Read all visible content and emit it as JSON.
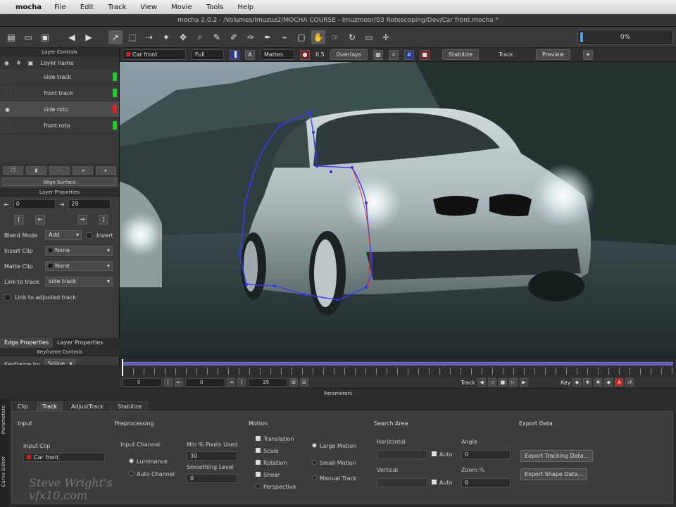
{
  "menubar": {
    "app": "mocha",
    "items": [
      "File",
      "Edit",
      "Track",
      "View",
      "Movie",
      "Tools",
      "Help"
    ]
  },
  "titlebar": {
    "text": "mocha 2.0.2 - /Volumes/Imuzuz2/MOCHA COURSE - Imuzmoor/03 Rotoscoping/Dev/Car front.mocha *"
  },
  "progress": {
    "text": "0%"
  },
  "viewer_bar": {
    "clip": "Car front",
    "view": "Full",
    "mattes": "Mattes",
    "opacity": "0.5",
    "overlays": "Overlays",
    "stabilize": "Stabilize",
    "track": "Track",
    "preview": "Preview"
  },
  "layer_controls": {
    "header": "Layer Controls",
    "column": "Layer name",
    "layers": [
      {
        "name": "side track",
        "color": "#22cc22"
      },
      {
        "name": "front track",
        "color": "#22cc22"
      },
      {
        "name": "side roto",
        "color": "#dd2222"
      },
      {
        "name": "front roto",
        "color": "#22cc22"
      }
    ],
    "align_surface": "Align Surface"
  },
  "layer_properties": {
    "header": "Layer Properties",
    "in_value": "0",
    "out_value": "29",
    "blend_mode_label": "Blend Mode",
    "blend_mode": "Add",
    "invert_label": "Invert",
    "insert_clip_label": "Insert Clip",
    "insert_clip": "None",
    "matte_clip_label": "Matte Clip",
    "matte_clip": "None",
    "link_track_label": "Link to track",
    "link_track": "side track",
    "link_adjusted_label": "Link to adjusted track"
  },
  "left_tabs": {
    "edge": "Edge Properties",
    "layer": "Layer Properties"
  },
  "keyframe": {
    "header": "Keyframe Controls",
    "label": "Keyframe by",
    "value": "Spline"
  },
  "transport": {
    "start": "0",
    "current": "0",
    "end": "29",
    "track": "Track",
    "key": "Key"
  },
  "parameters": {
    "header": "Parameters",
    "side_tabs": [
      "Parameters",
      "Curve Editor"
    ],
    "tabs": [
      "Clip",
      "Track",
      "AdjustTrack",
      "Stabilize"
    ],
    "input": {
      "title": "Input",
      "clip_label": "Input Clip",
      "clip": "Car front"
    },
    "preprocessing": {
      "title": "Preprocessing",
      "channel_label": "Input Channel",
      "luminance": "Luminance",
      "auto_channel": "Auto Channel",
      "min_pixels_label": "Min % Pixels Used",
      "min_pixels": "30",
      "smoothing_label": "Smoothing Level",
      "smoothing": "0"
    },
    "motion": {
      "title": "Motion",
      "checks": [
        "Translation",
        "Scale",
        "Rotation",
        "Shear",
        "Perspective"
      ],
      "radios": [
        "Large Motion",
        "Small Motion",
        "Manual Track"
      ]
    },
    "search_area": {
      "title": "Search Area",
      "horizontal": "Horizontal",
      "vertical": "Vertical",
      "auto": "Auto",
      "angle": "Angle",
      "angle_value": "0",
      "zoom": "Zoom %",
      "zoom_value": "0"
    },
    "export": {
      "title": "Export Data",
      "tracking": "Export Tracking Data...",
      "shape": "Export Shape Data..."
    }
  },
  "watermark": {
    "line1": "Steve Wright's",
    "line2": "vfx10.com"
  }
}
